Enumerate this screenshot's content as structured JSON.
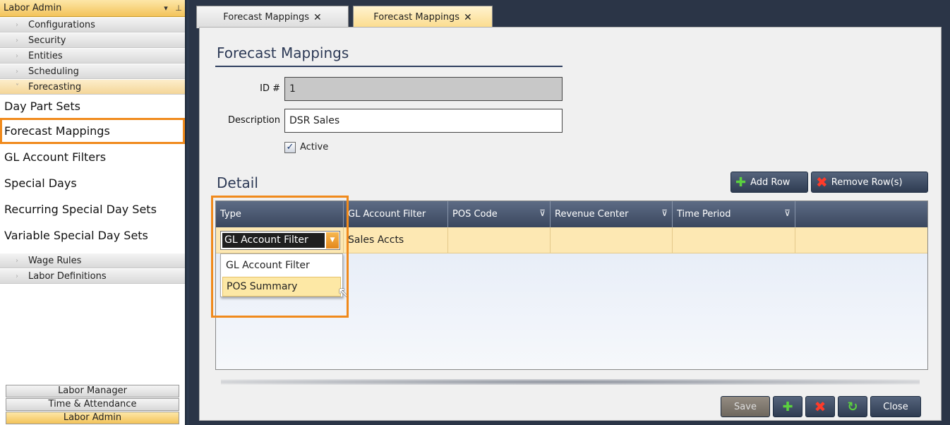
{
  "sidebar": {
    "header_title": "Labor Admin",
    "header_dropdown_glyph": "▾",
    "header_pin_glyph": "⊥",
    "categories": [
      {
        "label": "Configurations"
      },
      {
        "label": "Security"
      },
      {
        "label": "Entities"
      },
      {
        "label": "Scheduling"
      },
      {
        "label": "Forecasting"
      }
    ],
    "forecasting_items": [
      {
        "label": "Day Part Sets"
      },
      {
        "label": "Forecast Mappings",
        "selected": true
      },
      {
        "label": "GL Account Filters"
      },
      {
        "label": "Special Days"
      },
      {
        "label": "Recurring Special Day Sets"
      },
      {
        "label": "Variable Special Day Sets"
      }
    ],
    "lower_categories": [
      {
        "label": "Wage Rules"
      },
      {
        "label": "Labor Definitions"
      }
    ],
    "modules": [
      {
        "label": "Labor Manager"
      },
      {
        "label": "Time & Attendance"
      },
      {
        "label": "Labor Admin",
        "active": true
      }
    ]
  },
  "tabs": [
    {
      "label": "Forecast Mappings",
      "close": "✕"
    },
    {
      "label": "Forecast Mappings",
      "close": "✕",
      "active": true
    }
  ],
  "form": {
    "title": "Forecast Mappings",
    "id_label": "ID #",
    "id_value": "1",
    "description_label": "Description",
    "description_value": "DSR Sales",
    "active_label": "Active",
    "active_checked": true,
    "check_glyph": "✓"
  },
  "detail": {
    "title": "Detail",
    "add_row_label": "Add Row",
    "remove_rows_label": "Remove Row(s)",
    "columns": [
      {
        "label": "Type"
      },
      {
        "label": "GL Account Filter"
      },
      {
        "label": "POS Code"
      },
      {
        "label": "Revenue Center"
      },
      {
        "label": "Time Period"
      }
    ],
    "filter_glyph": "⊽",
    "row": {
      "type": "GL Account Filter",
      "gl_account_filter": "Sales Accts"
    },
    "type_options": [
      {
        "label": "GL Account Filter"
      },
      {
        "label": "POS Summary",
        "hover": true
      }
    ],
    "dropdown_arrow_glyph": "▼"
  },
  "footer": {
    "save_label": "Save",
    "close_label": "Close"
  },
  "icons": {
    "plus": "✚",
    "remove": "✖",
    "refresh": "↻",
    "cursor": "↖"
  },
  "colors": {
    "highlight": "#f08a1c",
    "grid_header": "#3a475e",
    "row_selected": "#fde8b3"
  }
}
